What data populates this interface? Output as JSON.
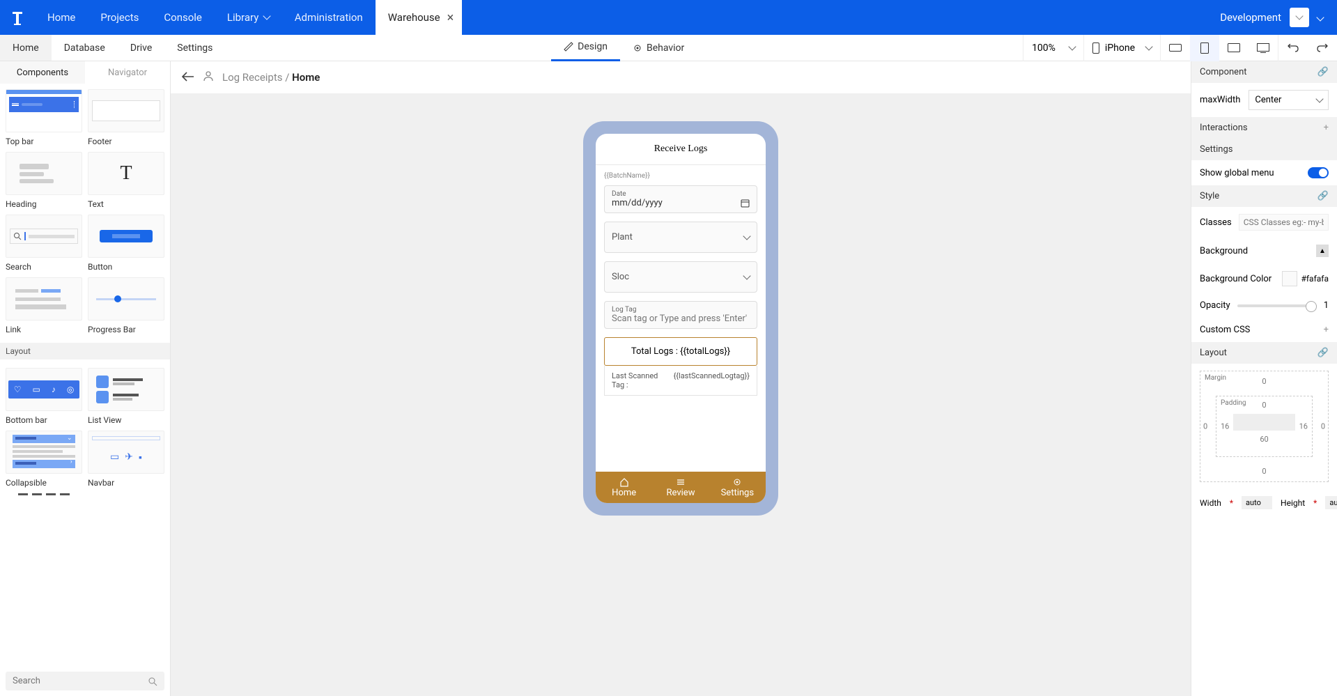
{
  "topbar": {
    "nav": [
      "Home",
      "Projects",
      "Console",
      "Library",
      "Administration"
    ],
    "activeTab": "Warehouse",
    "env": "Development"
  },
  "subbar": {
    "tabs": [
      "Home",
      "Database",
      "Drive",
      "Settings"
    ],
    "modes": {
      "design": "Design",
      "behavior": "Behavior"
    },
    "zoom": "100%",
    "device": "iPhone"
  },
  "leftPanel": {
    "tabs": {
      "components": "Components",
      "navigator": "Navigator"
    },
    "components": {
      "topbar": "Top bar",
      "footer": "Footer",
      "heading": "Heading",
      "text": "Text",
      "search": "Search",
      "button": "Button",
      "link": "Link",
      "progress": "Progress Bar",
      "bottombar": "Bottom bar",
      "listview": "List View",
      "collapsible": "Collapsible",
      "navbar": "Navbar"
    },
    "section_layout": "Layout",
    "searchPlaceholder": "Search"
  },
  "canvas": {
    "breadcrumb_parent": "Log Receipts",
    "breadcrumb_current": "Home"
  },
  "phone": {
    "title": "Receive Logs",
    "batch": "{{BatchName}}",
    "dateLabel": "Date",
    "datePlaceholder": "mm/dd/yyyy",
    "plant": "Plant",
    "sloc": "Sloc",
    "logTagLabel": "Log Tag",
    "logTagPlaceholder": "Scan tag or Type and press 'Enter'",
    "totalLogs": "Total Logs : {{totalLogs}}",
    "lastScanLabel": "Last Scanned Tag :",
    "lastScanValue": "{{lastScannedLogtag}}",
    "tabs": {
      "home": "Home",
      "review": "Review",
      "settings": "Settings"
    }
  },
  "rightPanel": {
    "component": "Component",
    "maxWidthLabel": "maxWidth",
    "maxWidthValue": "Center",
    "interactions": "Interactions",
    "settings": "Settings",
    "showGlobalMenu": "Show global menu",
    "style": "Style",
    "classesLabel": "Classes",
    "classesPlaceholder": "CSS Classes eg:- my-button",
    "background": "Background",
    "bgColorLabel": "Background Color",
    "bgColorValue": "#fafafa",
    "opacityLabel": "Opacity",
    "opacityValue": "1",
    "customCss": "Custom CSS",
    "layout": "Layout",
    "margin": "Margin",
    "padding": "Padding",
    "marginVals": {
      "top": "0",
      "right": "0",
      "bottom": "0",
      "left": "0"
    },
    "paddingVals": {
      "top": "0",
      "right": "16",
      "bottom": "60",
      "left": "16"
    },
    "widthLabel": "Width",
    "heightLabel": "Height",
    "auto": "auto"
  }
}
